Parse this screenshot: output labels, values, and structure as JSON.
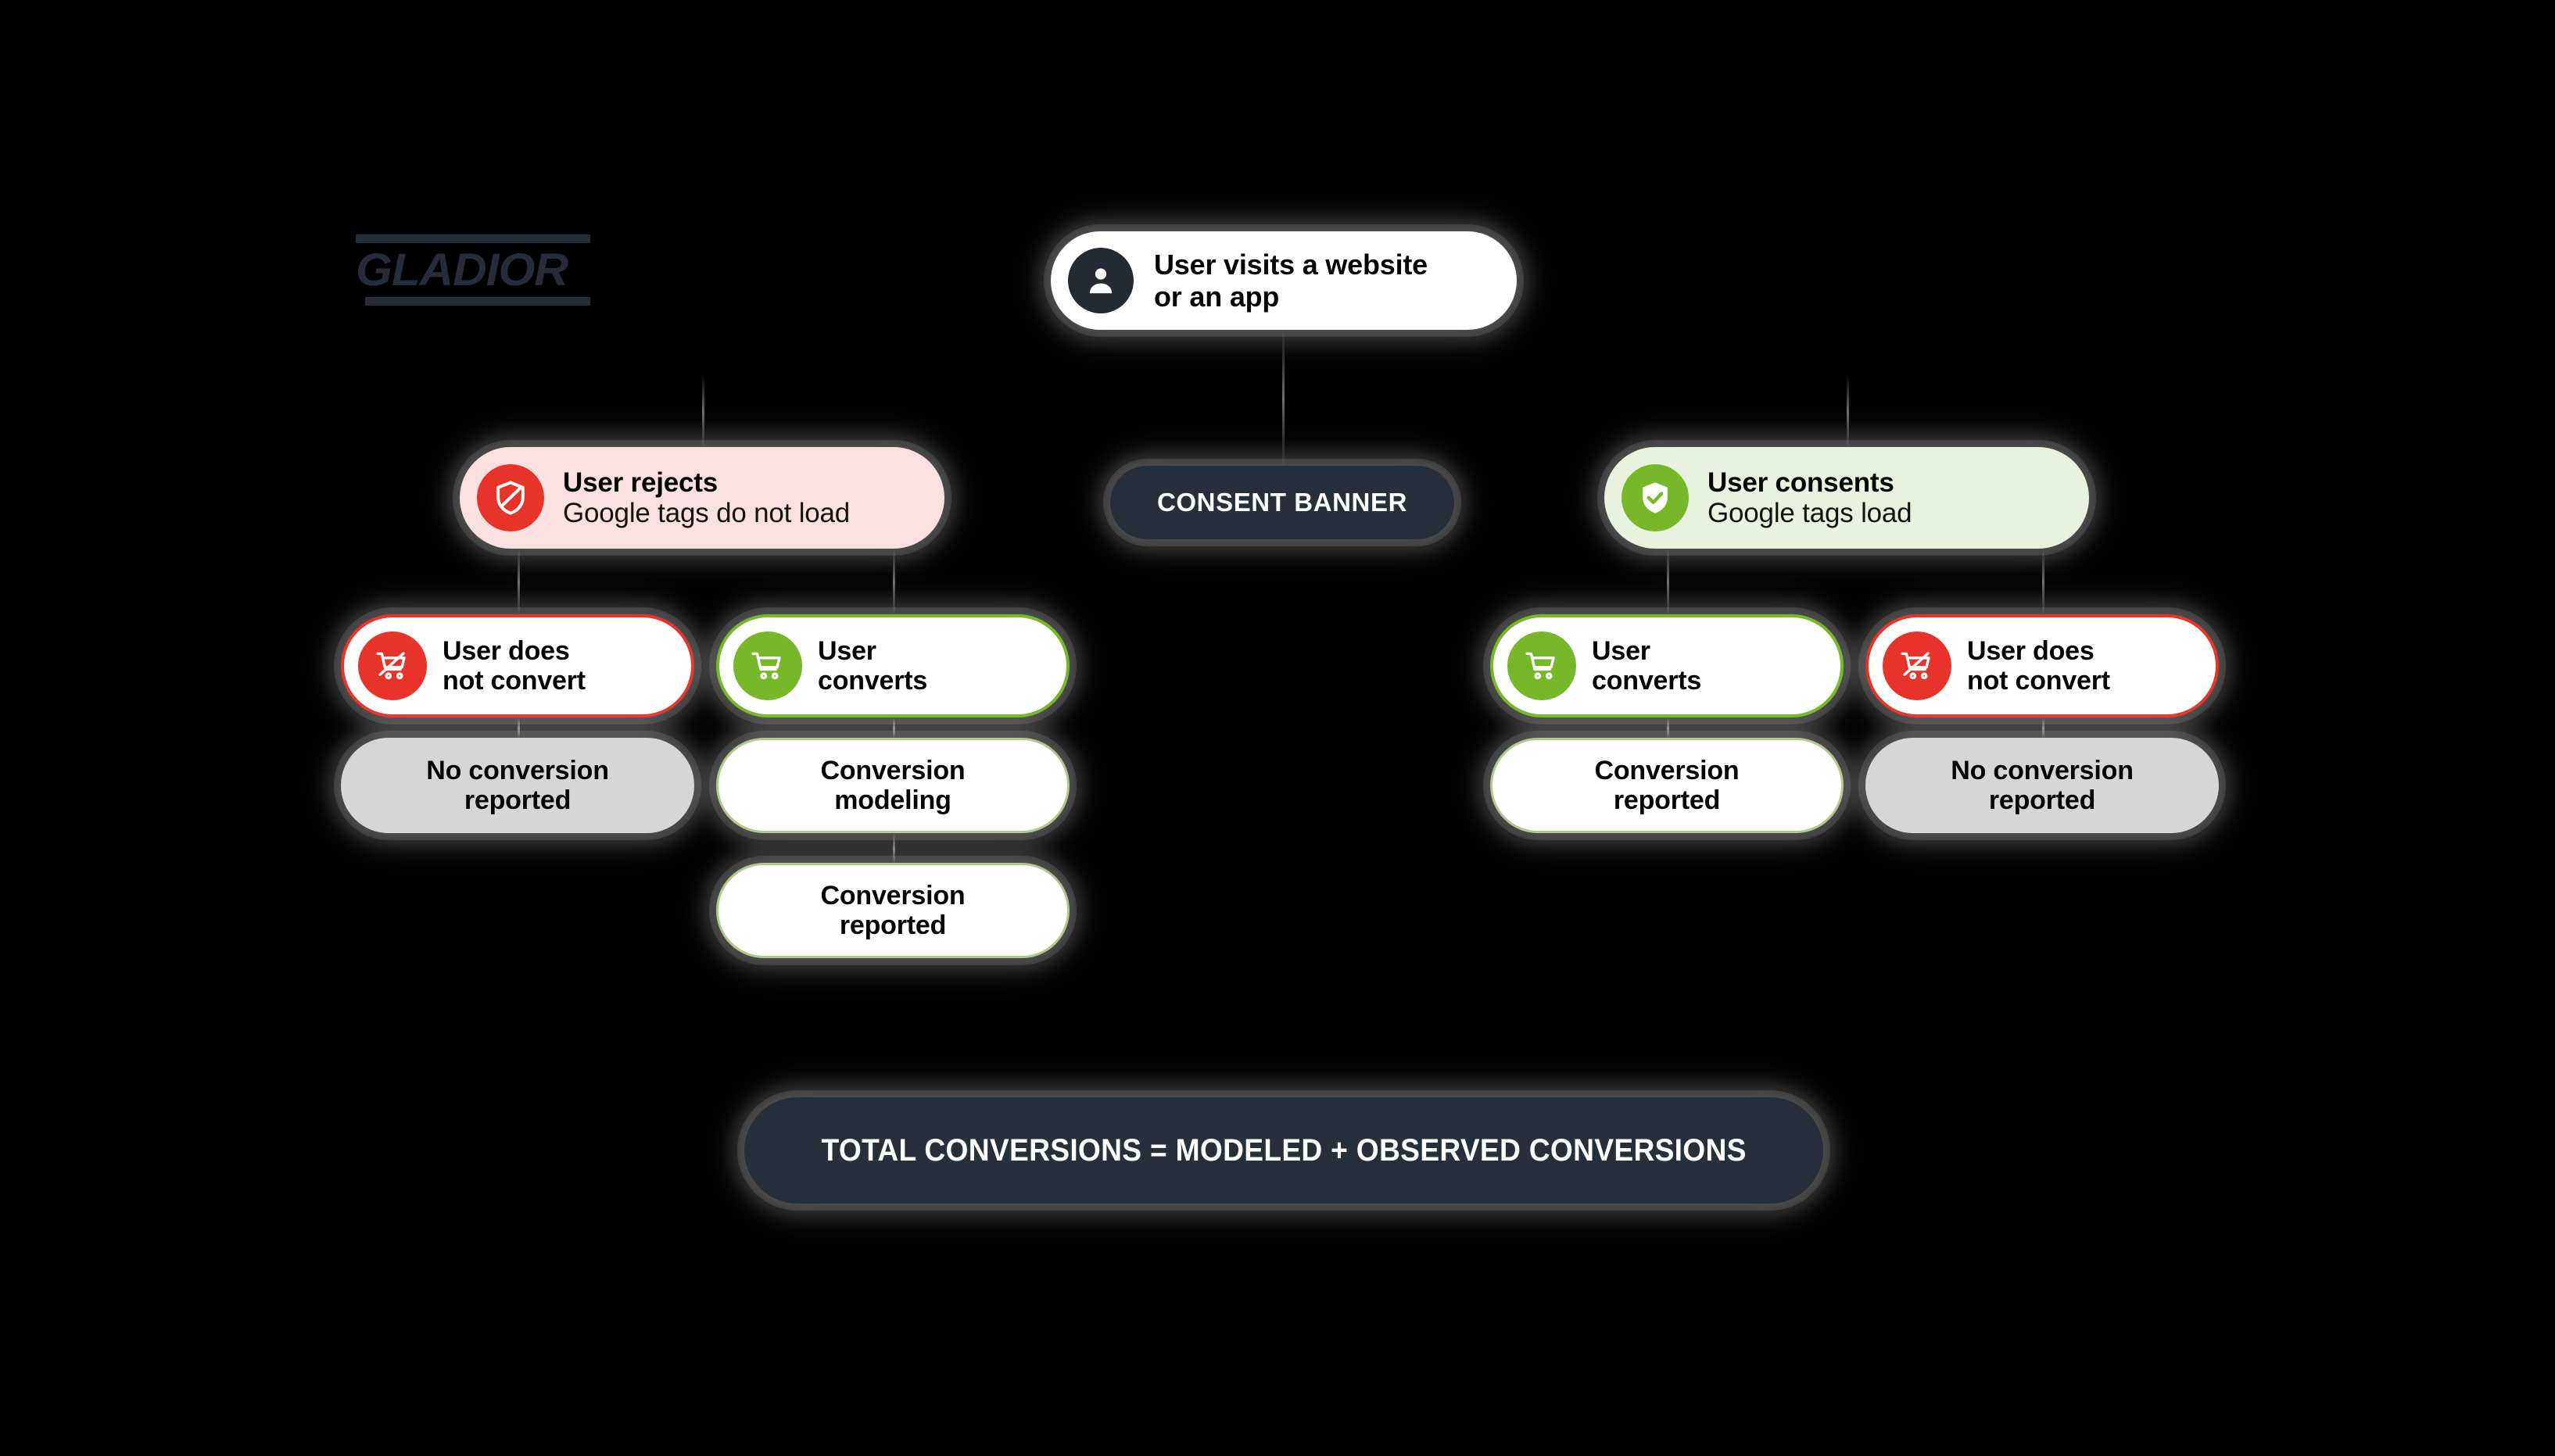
{
  "brand": {
    "logo_text": "GLADIOR",
    "logo_color": "#242E3A"
  },
  "colors": {
    "background": "#000000",
    "red": "#E8332A",
    "red_light": "#FBE0E0",
    "green": "#76B82A",
    "green_light": "#E8F2DC",
    "green_border": "#AECB8C",
    "dark_navy": "#26303A",
    "gray": "#D6D6D6",
    "white": "#FFFFFF"
  },
  "nodes": {
    "visit": {
      "icon": "person-icon",
      "line1": "User visits a website",
      "line2": "or an app"
    },
    "consent_banner": {
      "label": "CONSENT BANNER"
    },
    "reject": {
      "icon": "shield-block-icon",
      "line1": "User rejects",
      "line2": "Google tags do not load"
    },
    "consent": {
      "icon": "shield-check-icon",
      "line1": "User consents",
      "line2": "Google tags load"
    },
    "left_not_convert": {
      "icon": "cart-crossed-icon",
      "line1": "User does",
      "line2": "not convert"
    },
    "left_converts": {
      "icon": "cart-icon",
      "line1": "User",
      "line2": "converts"
    },
    "right_converts": {
      "icon": "cart-icon",
      "line1": "User",
      "line2": "converts"
    },
    "right_not_convert": {
      "icon": "cart-crossed-icon",
      "line1": "User does",
      "line2": "not convert"
    }
  },
  "outcomes": {
    "left_no_conversion": {
      "line1": "No conversion",
      "line2": "reported"
    },
    "left_modeling": {
      "line1": "Conversion",
      "line2": "modeling"
    },
    "left_reported": {
      "line1": "Conversion",
      "line2": "reported"
    },
    "right_reported": {
      "line1": "Conversion",
      "line2": "reported"
    },
    "right_no_conversion": {
      "line1": "No conversion",
      "line2": "reported"
    }
  },
  "total": {
    "label": "TOTAL CONVERSIONS = MODELED + OBSERVED CONVERSIONS"
  }
}
